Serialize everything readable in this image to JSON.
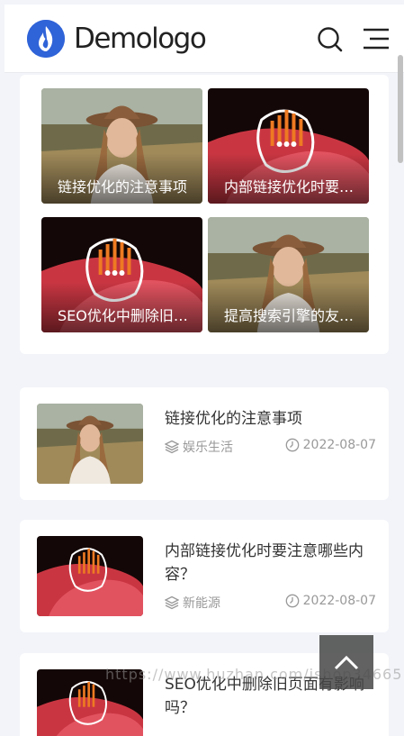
{
  "header": {
    "logo_text": "Demologo"
  },
  "icons": {
    "search": "search-icon",
    "menu": "menu-icon",
    "category": "layers-icon",
    "date": "clock-icon",
    "back_top": "chevron-up-icon",
    "logo": "flame-icon"
  },
  "colors": {
    "brand": "#2f63d8",
    "meta": "#999999",
    "title": "#333333"
  },
  "featured": [
    {
      "title": "链接优化的注意事项"
    },
    {
      "title": "内部链接优化时要注意哪些内容？"
    },
    {
      "title": "SEO优化中删除旧页面有影响吗？"
    },
    {
      "title": "提高搜索引擎的友好度"
    }
  ],
  "articles": [
    {
      "title": "链接优化的注意事项",
      "category": "娱乐生活",
      "date": "2022-08-07"
    },
    {
      "title": "内部链接优化时要注意哪些内容？",
      "category": "新能源",
      "date": "2022-08-07"
    },
    {
      "title": "SEO优化中删除旧页面有影响吗？"
    }
  ],
  "watermark": "https://www.huzhan.com/ishop34665"
}
